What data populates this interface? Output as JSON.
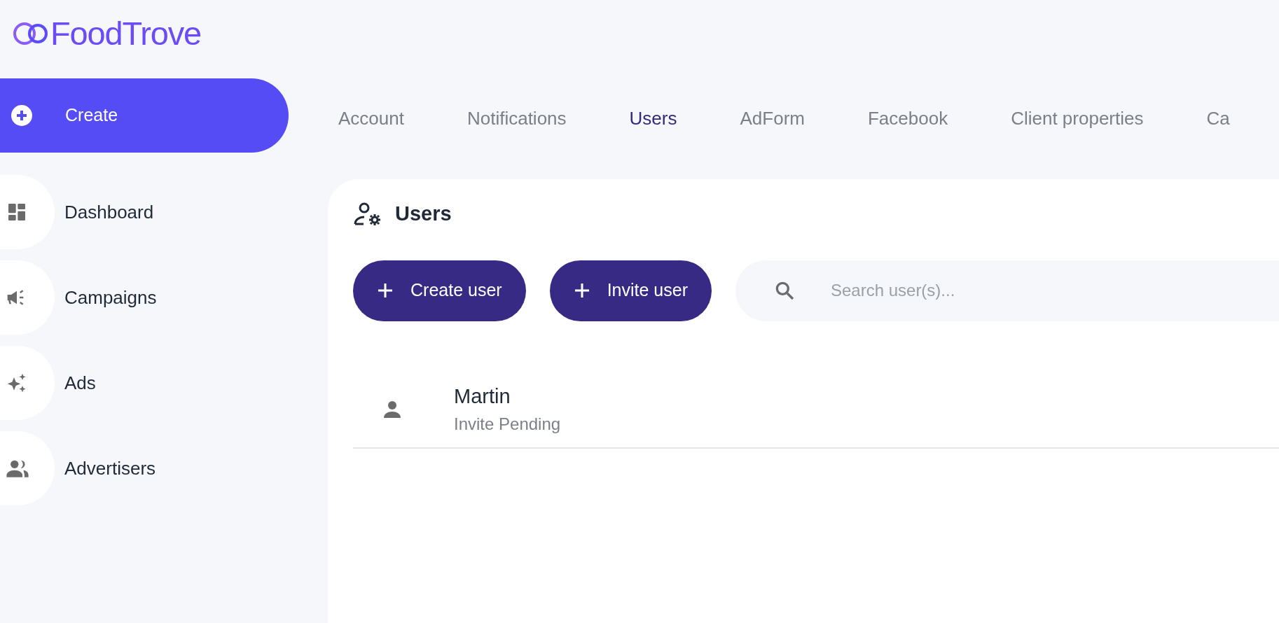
{
  "logo": {
    "text": "FoodTrove"
  },
  "sidebar": {
    "create": {
      "label": "Create"
    },
    "items": [
      {
        "label": "Dashboard"
      },
      {
        "label": "Campaigns"
      },
      {
        "label": "Ads"
      },
      {
        "label": "Advertisers"
      }
    ]
  },
  "tabs": [
    {
      "label": "Account",
      "selected": false
    },
    {
      "label": "Notifications",
      "selected": false
    },
    {
      "label": "Users",
      "selected": true
    },
    {
      "label": "AdForm",
      "selected": false
    },
    {
      "label": "Facebook",
      "selected": false
    },
    {
      "label": "Client properties",
      "selected": false
    },
    {
      "label": "Ca",
      "selected": false
    }
  ],
  "panel": {
    "title": "Users",
    "buttons": [
      "Create user",
      "Invite user"
    ],
    "search": {
      "placeholder": "Search user(s)..."
    },
    "users": [
      {
        "name": "Martin",
        "status": "Invite Pending"
      }
    ]
  }
}
